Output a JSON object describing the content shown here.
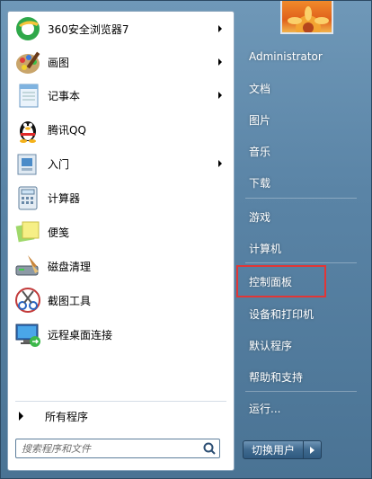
{
  "programs": [
    {
      "label": "360安全浏览器7",
      "icon": "browser-360-icon",
      "submenu": true
    },
    {
      "label": "画图",
      "icon": "paint-icon",
      "submenu": true
    },
    {
      "label": "记事本",
      "icon": "notepad-icon",
      "submenu": true
    },
    {
      "label": "腾讯QQ",
      "icon": "qq-penguin-icon",
      "submenu": false
    },
    {
      "label": "入门",
      "icon": "getting-started-icon",
      "submenu": true
    },
    {
      "label": "计算器",
      "icon": "calculator-icon",
      "submenu": false
    },
    {
      "label": "便笺",
      "icon": "sticky-notes-icon",
      "submenu": false
    },
    {
      "label": "磁盘清理",
      "icon": "disk-cleanup-icon",
      "submenu": false
    },
    {
      "label": "截图工具",
      "icon": "snipping-tool-icon",
      "submenu": false
    },
    {
      "label": "远程桌面连接",
      "icon": "remote-desktop-icon",
      "submenu": false
    }
  ],
  "all_programs": "所有程序",
  "search": {
    "placeholder": "搜索程序和文件"
  },
  "right_panel": {
    "user": "Administrator",
    "items": [
      "文档",
      "图片",
      "音乐",
      "下载",
      "游戏",
      "计算机",
      "控制面板",
      "设备和打印机",
      "默认程序",
      "帮助和支持",
      "运行..."
    ]
  },
  "shutdown": {
    "label": "切换用户"
  },
  "colors": {
    "highlight": "#e23636",
    "panel": "#5a84a6"
  }
}
